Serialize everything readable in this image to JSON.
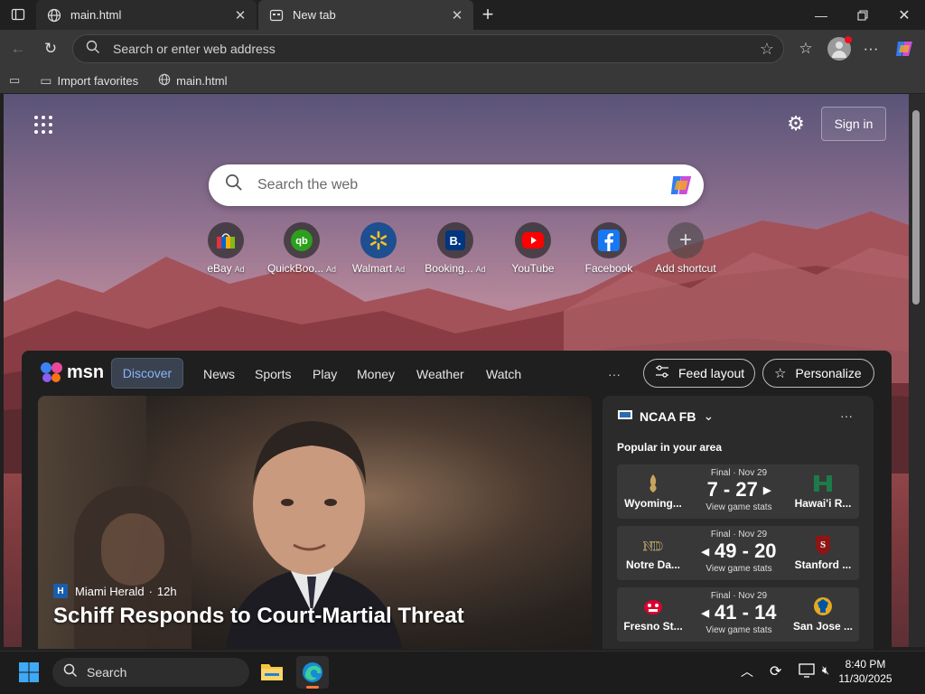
{
  "browser": {
    "tabs": [
      {
        "title": "main.html",
        "active": false
      },
      {
        "title": "New tab",
        "active": true
      }
    ],
    "address_placeholder": "Search or enter web address",
    "favorites": [
      {
        "label": "Import favorites"
      },
      {
        "label": "main.html"
      }
    ]
  },
  "ntp": {
    "signin_label": "Sign in",
    "search_placeholder": "Search the web",
    "quick_links": [
      {
        "label": "eBay",
        "ad": "Ad"
      },
      {
        "label": "QuickBoo...",
        "ad": "Ad"
      },
      {
        "label": "Walmart",
        "ad": "Ad"
      },
      {
        "label": "Booking...",
        "ad": "Ad"
      },
      {
        "label": "YouTube",
        "ad": ""
      },
      {
        "label": "Facebook",
        "ad": ""
      },
      {
        "label": "Add shortcut",
        "ad": ""
      }
    ]
  },
  "msn": {
    "brand": "msn",
    "nav": [
      "Discover",
      "News",
      "Sports",
      "Play",
      "Money",
      "Weather",
      "Watch"
    ],
    "more": "···",
    "feed_layout_label": "Feed layout",
    "personalize_label": "Personalize",
    "hero": {
      "source": "Miami Herald",
      "time": "12h",
      "title": "Schiff Responds to Court-Martial Threat"
    },
    "sports": {
      "title": "NCAA FB",
      "subtitle": "Popular in your area",
      "more": "···",
      "games": [
        {
          "team1": "Wyoming...",
          "team2": "Hawai'i R...",
          "status": "Final · Nov 29",
          "score": "7 - 27",
          "winner": "right",
          "stats": "View game stats"
        },
        {
          "team1": "Notre Da...",
          "team2": "Stanford ...",
          "status": "Final · Nov 29",
          "score": "49 - 20",
          "winner": "left",
          "stats": "View game stats"
        },
        {
          "team1": "Fresno St...",
          "team2": "San Jose ...",
          "status": "Final · Nov 29",
          "score": "41 - 14",
          "winner": "left",
          "stats": "View game stats"
        }
      ]
    }
  },
  "taskbar": {
    "search_label": "Search",
    "time": "8:40 PM",
    "date": "11/30/2025"
  }
}
